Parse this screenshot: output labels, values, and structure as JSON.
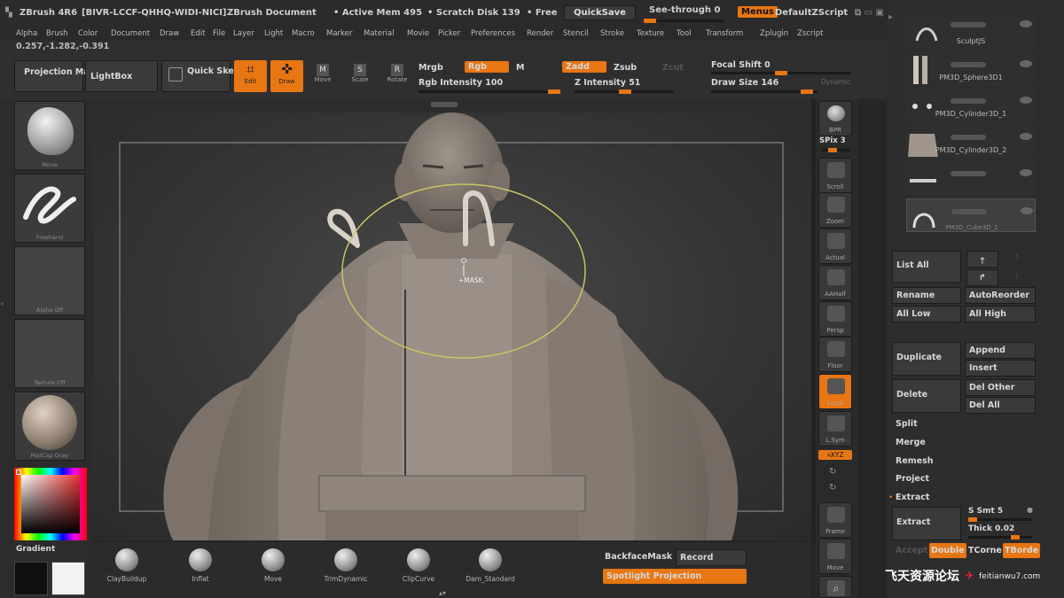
{
  "title_bar": {
    "app": "ZBrush 4R6",
    "serial": "[BIVR-LCCF-QHHQ-WIDI-NICI]",
    "document": "ZBrush Document",
    "active_mem": "• Active Mem 495",
    "scratch": "• Scratch Disk 139",
    "free": "• Free",
    "quicksave": "QuickSave",
    "see_through": "See-through  0",
    "menus": "Menus",
    "script": "DefaultZScript"
  },
  "menu_items": [
    "Alpha",
    "Brush",
    "Color",
    "Document",
    "Draw",
    "Edit",
    "File",
    "Layer",
    "Light",
    "Macro",
    "Marker",
    "Material",
    "Movie",
    "Picker",
    "Preferences",
    "Render",
    "Stencil",
    "Stroke",
    "Texture",
    "Tool",
    "Transform",
    "Zplugin",
    "Zscript"
  ],
  "coords": "0.257,-1.282,-0.391",
  "shelf": {
    "projection_master": "Projection Master",
    "lightbox": "LightBox",
    "quick_sketch": "Quick Sketch",
    "edit": "Edit",
    "draw": "Draw",
    "move": "Move",
    "scale": "Scale",
    "rotate": "Rotate",
    "mrgb": "Mrgb",
    "rgb": "Rgb",
    "m": "M",
    "rgb_intensity": "Rgb  Intensity 100",
    "zadd": "Zadd",
    "zsub": "Zsub",
    "zcut": "Zcut",
    "z_intensity": "Z Intensity 51",
    "focal_shift": "Focal Shift 0",
    "draw_size": "Draw Size 146",
    "dynamic": "Dynamic",
    "rgb_intensity_value": 100,
    "z_intensity_value": 51,
    "focal_shift_value": 0,
    "draw_size_value": 146
  },
  "left_tiles": [
    "Move",
    "Freehand",
    "Alpha Off",
    "Texture Off",
    "MatCap Gray"
  ],
  "gradient_label": "Gradient",
  "viewport": {
    "cursor_label": "+MASK"
  },
  "right_tools": [
    {
      "label": "BPR",
      "icon": "bpr-icon"
    },
    {
      "label": "Scroll",
      "icon": "scroll-icon"
    },
    {
      "label": "Zoom",
      "icon": "zoom-icon"
    },
    {
      "label": "Actual",
      "icon": "actual-icon"
    },
    {
      "label": "AAHalf",
      "icon": "aahalf-icon"
    },
    {
      "label": "Persp",
      "icon": "persp-icon"
    },
    {
      "label": "Floor",
      "icon": "floor-icon"
    },
    {
      "label": "Local",
      "icon": "local-icon"
    },
    {
      "label": "L.Sym",
      "icon": "lsym-icon"
    },
    {
      "label": "Frame",
      "icon": "frame-icon"
    },
    {
      "label": "Move",
      "icon": "move-icon"
    }
  ],
  "spix": "SPix 3",
  "xyz": "»XYZ",
  "subtools": [
    "SculptJ",
    "SculptJS",
    "PM3D_Sphere3D1",
    "PM3D_Cylinder3D_1",
    "PM3D_Cylinder3D_2",
    "PM3D_Cube3D_1"
  ],
  "subtool_buttons": {
    "list_all": "List All",
    "rename": "Rename",
    "auto_reorder": "AutoReorder",
    "all_low": "All Low",
    "all_high": "All High",
    "duplicate": "Duplicate",
    "append": "Append",
    "insert": "Insert",
    "delete": "Delete",
    "del_other": "Del Other",
    "del_all": "Del All",
    "split": "Split",
    "merge": "Merge",
    "remesh": "Remesh",
    "project": "Project",
    "extract_header": "Extract",
    "extract": "Extract",
    "s_smt": "S Smt 5",
    "thick": "Thick 0.02",
    "accept": "Accept",
    "double": "Double",
    "tcorne": "TCorne",
    "tborde": "TBorde"
  },
  "brushes": [
    "ClayBuildup",
    "Inflat",
    "Move",
    "TrimDynamic",
    "ClipCurve",
    "Dam_Standard"
  ],
  "bottom": {
    "backface_mask": "BackfaceMask",
    "record": "Record",
    "spotlight": "Spotlight Projection"
  },
  "watermark": {
    "cn": "飞天资源论坛",
    "url": "feitianwu7.com"
  },
  "colors": {
    "accent": "#e87613",
    "panel": "#2d2d2d",
    "viewport": "#3c3c3c",
    "model": "#8d8379"
  }
}
